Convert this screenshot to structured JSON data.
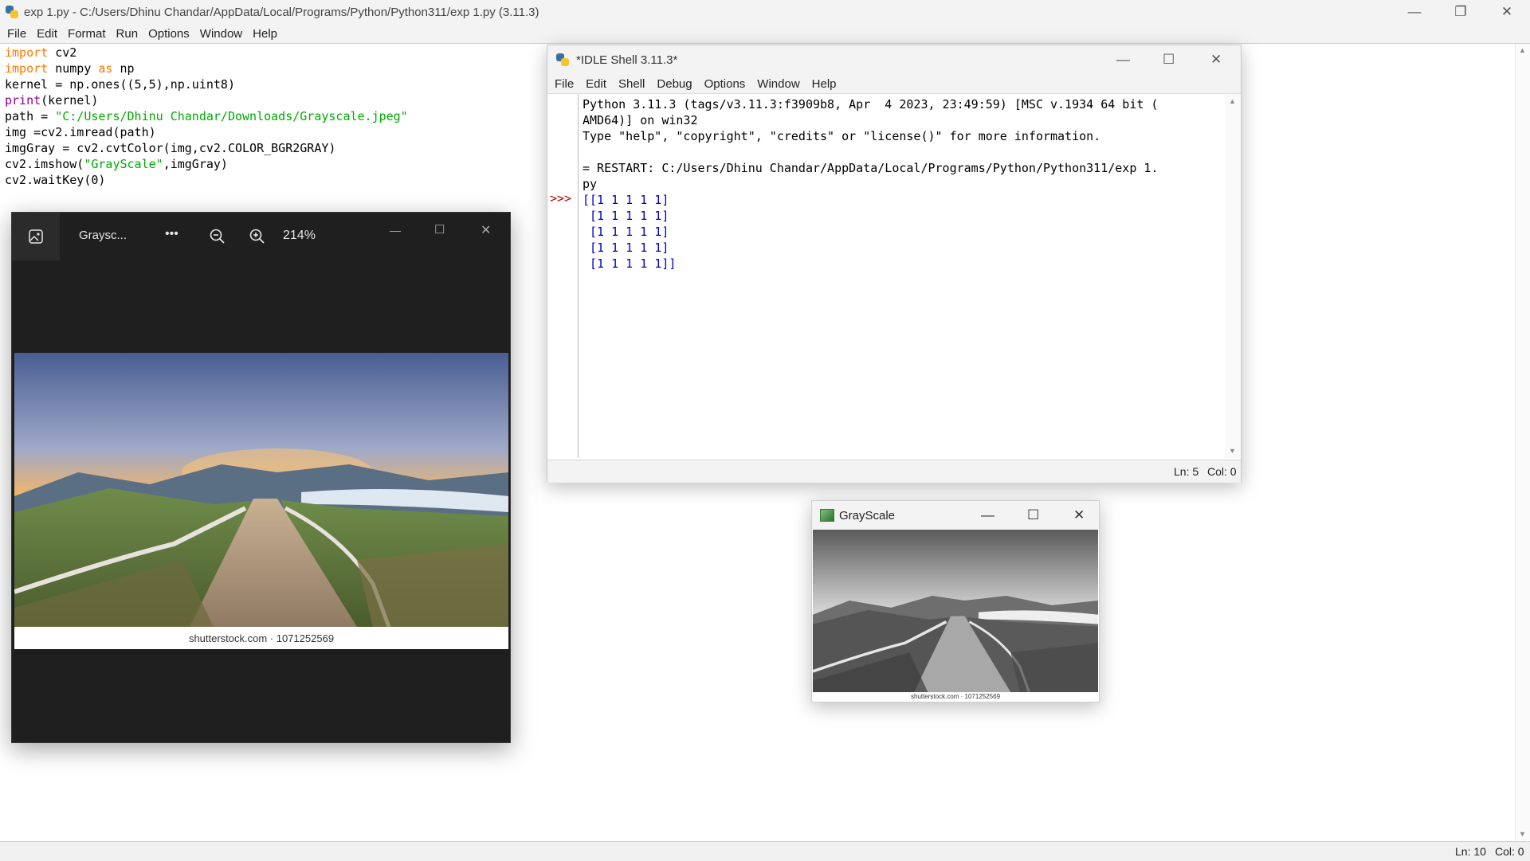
{
  "editor": {
    "title": "exp 1.py - C:/Users/Dhinu Chandar/AppData/Local/Programs/Python/Python311/exp 1.py (3.11.3)",
    "menu": [
      "File",
      "Edit",
      "Format",
      "Run",
      "Options",
      "Window",
      "Help"
    ],
    "code": [
      {
        "kw": "import",
        "rest": " cv2"
      },
      {
        "kw": "import",
        "mid": " numpy ",
        "kw2": "as",
        "rest": " np"
      },
      {
        "plain": "kernel = np.ones((5,5),np.uint8)"
      },
      {
        "bi": "print",
        "rest": "(kernel)"
      },
      {
        "pre": "path = ",
        "str": "\"C:/Users/Dhinu Chandar/Downloads/Grayscale.jpeg\""
      },
      {
        "plain": "img =cv2.imread(path)"
      },
      {
        "plain": "imgGray = cv2.cvtColor(img,cv2.COLOR_BGR2GRAY)"
      },
      {
        "pre": "cv2.imshow(",
        "str": "\"GrayScale\"",
        "rest": ",imgGray)"
      },
      {
        "plain": "cv2.waitKey(0)"
      }
    ],
    "status_ln": "Ln: 10",
    "status_col": "Col: 0"
  },
  "photos": {
    "title": "Graysc...",
    "more_label": "•••",
    "zoom": "214%",
    "caption": "shutterstock.com · 1071252569"
  },
  "shell": {
    "title": "*IDLE Shell 3.11.3*",
    "menu": [
      "File",
      "Edit",
      "Shell",
      "Debug",
      "Options",
      "Window",
      "Help"
    ],
    "prompt": ">>>",
    "lines": [
      "Python 3.11.3 (tags/v3.11.3:f3909b8, Apr  4 2023, 23:49:59) [MSC v.1934 64 bit (",
      "AMD64)] on win32",
      "Type \"help\", \"copyright\", \"credits\" or \"license()\" for more information.",
      "",
      "= RESTART: C:/Users/Dhinu Chandar/AppData/Local/Programs/Python/Python311/exp 1.",
      "py"
    ],
    "output": [
      "[[1 1 1 1 1]",
      " [1 1 1 1 1]",
      " [1 1 1 1 1]",
      " [1 1 1 1 1]",
      " [1 1 1 1 1]]"
    ],
    "status_ln": "Ln: 5",
    "status_col": "Col: 0"
  },
  "gray": {
    "title": "GrayScale",
    "caption": "shutterstock.com · 1071252569"
  }
}
